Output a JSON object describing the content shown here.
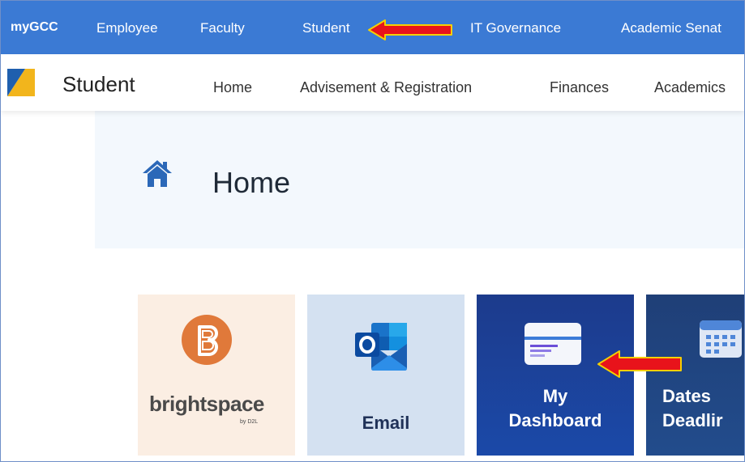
{
  "topnav": {
    "brand": "myGCC",
    "items": [
      {
        "label": "Employee"
      },
      {
        "label": "Faculty"
      },
      {
        "label": "Student"
      },
      {
        "label": "IT Governance"
      },
      {
        "label": "Academic Senat"
      }
    ],
    "background": "#3b7ad4"
  },
  "subnav": {
    "title": "Student",
    "links": [
      {
        "label": "Home"
      },
      {
        "label": "Advisement & Registration"
      },
      {
        "label": "Finances"
      },
      {
        "label": "Academics"
      }
    ]
  },
  "hero": {
    "icon": "home-icon",
    "title": "Home"
  },
  "tiles": [
    {
      "id": "brightspace",
      "label": "",
      "logo_text": "brightspace",
      "logo_sub": "by D2L",
      "icon": "brightspace-logo"
    },
    {
      "id": "email",
      "label": "Email",
      "icon": "outlook-icon"
    },
    {
      "id": "dashboard",
      "label_line1": "My",
      "label_line2": "Dashboard",
      "icon": "dashboard-icon"
    },
    {
      "id": "dates",
      "label_line1": "Dates",
      "label_line2": "Deadlir",
      "icon": "calendar-icon"
    }
  ],
  "annotations": {
    "arrow_color": "#e8131b",
    "arrow_outline": "#f5d000"
  }
}
